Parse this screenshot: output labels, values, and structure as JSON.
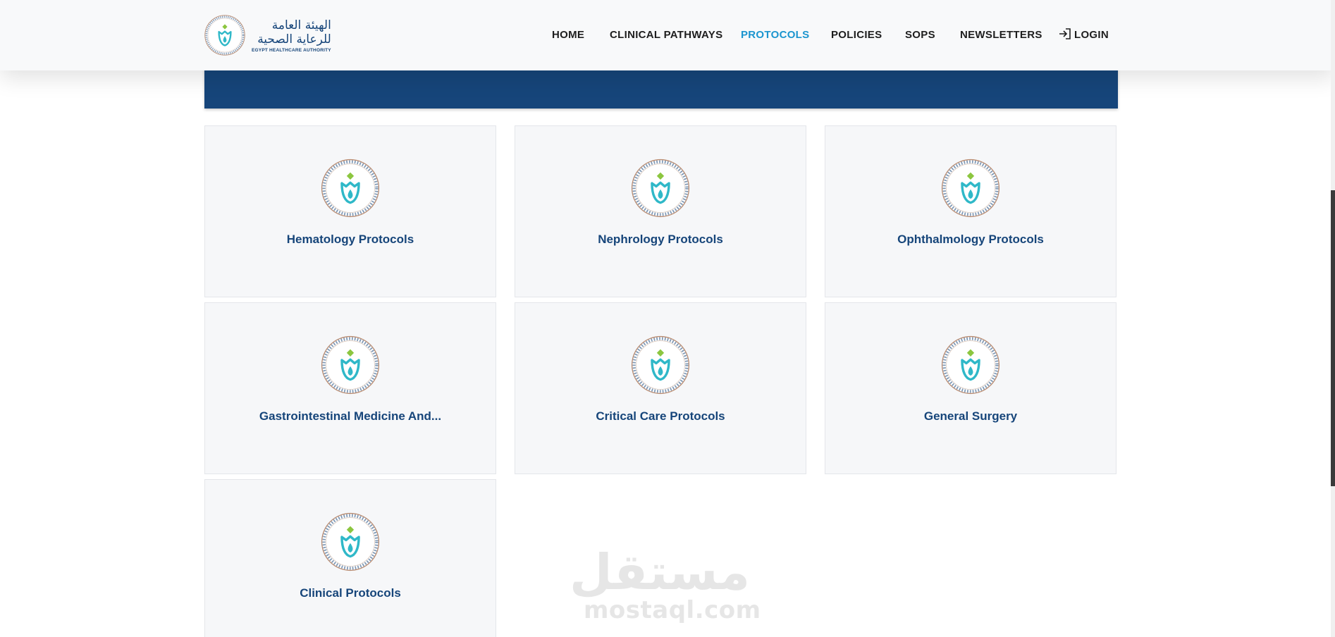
{
  "brand": {
    "name_ar_line1": "الهيئة العامة",
    "name_ar_line2": "للرعاية الصحية",
    "name_en": "EGYPT HEALTHCARE AUTHORITY",
    "primary_color": "#16457a",
    "accent_color": "#1b95cf"
  },
  "nav": {
    "items": [
      {
        "label": "HOME",
        "active": false
      },
      {
        "label": "CLINICAL PATHWAYS",
        "active": false
      },
      {
        "label": "PROTOCOLS",
        "active": true
      },
      {
        "label": "POLICIES",
        "active": false
      },
      {
        "label": "SOPS",
        "active": false
      },
      {
        "label": "NEWSLETTERS",
        "active": false
      }
    ],
    "login_label": "LOGIN",
    "login_icon": "login-icon"
  },
  "cards": [
    {
      "title": "Hematology Protocols",
      "icon": "eha-logo-icon"
    },
    {
      "title": "Nephrology Protocols",
      "icon": "eha-logo-icon"
    },
    {
      "title": "Ophthalmology Protocols",
      "icon": "eha-logo-icon"
    },
    {
      "title": "Gastrointestinal Medicine And...",
      "icon": "eha-logo-icon"
    },
    {
      "title": "Critical Care Protocols",
      "icon": "eha-logo-icon"
    },
    {
      "title": "General Surgery",
      "icon": "eha-logo-icon"
    },
    {
      "title": "Clinical Protocols",
      "icon": "eha-logo-icon"
    }
  ],
  "watermark": {
    "text_ar": "مستقل",
    "text_en": "mostaql.com"
  }
}
